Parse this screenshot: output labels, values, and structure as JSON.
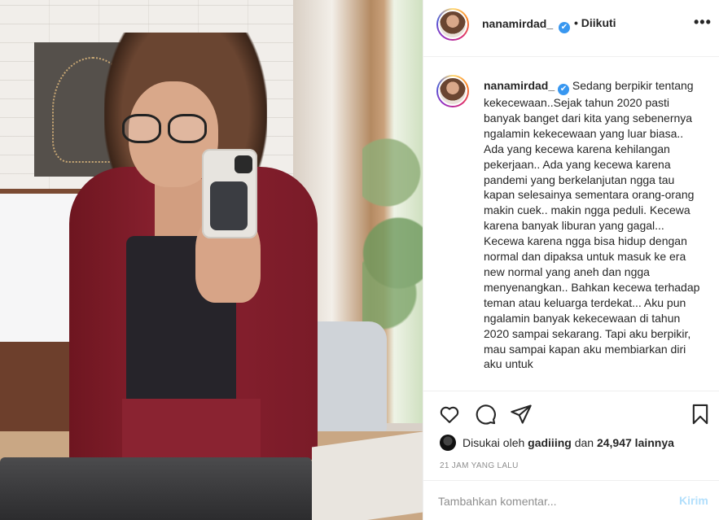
{
  "post": {
    "username": "nanamirdad_",
    "follow_status": "• Diikuti",
    "verified_mark": "✔",
    "more_icon": "•••",
    "caption": "Sedang berpikir tentang kekecewaan..Sejak tahun 2020 pasti banyak banget dari kita yang sebenernya ngalamin kekecewaan yang luar biasa.. Ada yang kecewa karena kehilangan pekerjaan.. Ada yang kecewa karena pandemi yang berkelanjutan ngga tau kapan selesainya sementara orang-orang makin cuek.. makin ngga peduli. Kecewa karena banyak liburan yang gagal... Kecewa karena ngga bisa hidup dengan normal dan dipaksa untuk masuk ke era new normal yang aneh dan ngga menyenangkan.. Bahkan kecewa terhadap teman atau keluarga terdekat... Aku pun ngalamin banyak kekecewaan di tahun 2020 sampai sekarang. Tapi aku berpikir, mau sampai kapan aku membiarkan diri aku untuk",
    "likes": {
      "prefix": "Disukai oleh",
      "liker": "gadiiing",
      "joiner": "dan",
      "count": "24,947 lainnya"
    },
    "timestamp": "21 JAM YANG LALU"
  },
  "comment": {
    "placeholder": "Tambahkan komentar...",
    "send_label": "Kirim"
  },
  "icons": {
    "like": "heart-icon",
    "comment": "comment-icon",
    "share": "paper-plane-icon",
    "save": "bookmark-icon"
  },
  "colors": {
    "verified": "#3897f0",
    "send_disabled": "#b2dffc",
    "muted": "#8e8e8e",
    "text": "#262626"
  }
}
